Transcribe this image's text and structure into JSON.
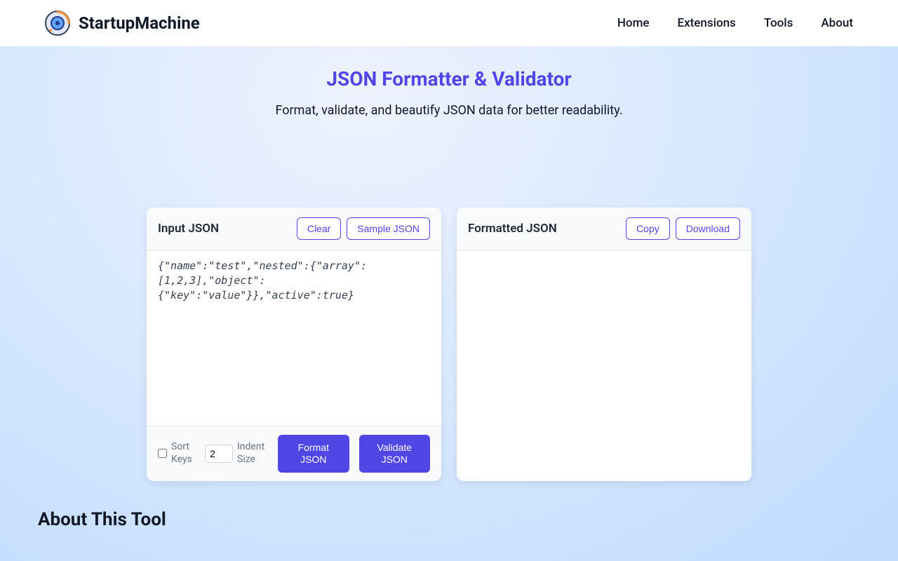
{
  "brand": "StartupMachine",
  "nav": {
    "home": "Home",
    "extensions": "Extensions",
    "tools": "Tools",
    "about": "About"
  },
  "page": {
    "title": "JSON Formatter & Validator",
    "subtitle": "Format, validate, and beautify JSON data for better readability."
  },
  "input_card": {
    "title": "Input JSON",
    "clear": "Clear",
    "sample": "Sample JSON",
    "value": "{\"name\":\"test\",\"nested\":{\"array\":[1,2,3],\"object\":{\"key\":\"value\"}},\"active\":true}",
    "sort_keys_label": "Sort Keys",
    "indent_value": "2",
    "indent_label": "Indent Size",
    "format_btn": "Format JSON",
    "validate_btn": "Validate JSON"
  },
  "output_card": {
    "title": "Formatted JSON",
    "copy": "Copy",
    "download": "Download"
  },
  "about_section": {
    "title": "About This Tool"
  }
}
